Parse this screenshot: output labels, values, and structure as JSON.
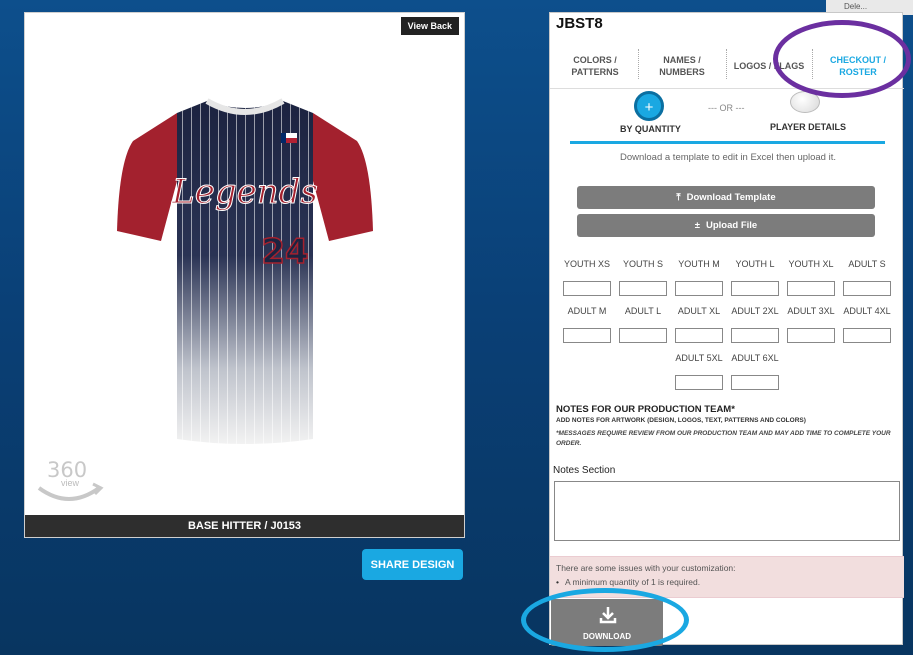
{
  "corner_snippet": "Dele...",
  "preview": {
    "view_back_label": "View Back",
    "jersey": {
      "team_text": "Legends",
      "number": "24",
      "flag": "Texas flag"
    },
    "rotate_360": {
      "big": "360",
      "small": "view"
    },
    "product_name": "BASE HITTER / J0153",
    "share_label": "SHARE DESIGN"
  },
  "panel": {
    "title": "JBST8",
    "tabs": [
      {
        "line1": "COLORS /",
        "line2": "PATTERNS",
        "active": false
      },
      {
        "line1": "NAMES /",
        "line2": "NUMBERS",
        "active": false
      },
      {
        "line1": "LOGOS / FLAGS",
        "line2": "",
        "active": false
      },
      {
        "line1": "CHECKOUT /",
        "line2": "ROSTER",
        "active": true
      }
    ],
    "modes": {
      "quantity_symbol": "+",
      "or_text": "--- OR ---",
      "by_quantity": "BY QUANTITY",
      "player_details": "PLAYER DETAILS"
    },
    "help_text": "Download a template to edit in Excel then upload it.",
    "download_template": "Download Template",
    "upload_file": "Upload File",
    "sizes": [
      "YOUTH XS",
      "YOUTH S",
      "YOUTH M",
      "YOUTH L",
      "YOUTH XL",
      "ADULT S",
      "ADULT M",
      "ADULT L",
      "ADULT XL",
      "ADULT 2XL",
      "ADULT 3XL",
      "ADULT 4XL",
      "ADULT 5XL",
      "ADULT 6XL"
    ],
    "notes": {
      "heading": "NOTES FOR OUR PRODUCTION TEAM*",
      "sub": "ADD NOTES FOR ARTWORK (DESIGN, LOGOS, TEXT, PATTERNS AND COLORS)",
      "warning": "*MESSAGES REQUIRE REVIEW FROM OUR PRODUCTION TEAM AND MAY ADD TIME TO COMPLETE YOUR ORDER.",
      "label": "Notes Section",
      "value": ""
    },
    "issues": {
      "message": "There are some issues with your customization:",
      "items": [
        "A minimum quantity of 1 is required."
      ]
    },
    "download_label": "DOWNLOAD"
  },
  "colors": {
    "accent": "#1aa8e2",
    "background": "#0d4f8c",
    "jersey_sleeve": "#a3212e",
    "jersey_body": "#1c2340",
    "annotation_purple": "#6b2fa0"
  }
}
